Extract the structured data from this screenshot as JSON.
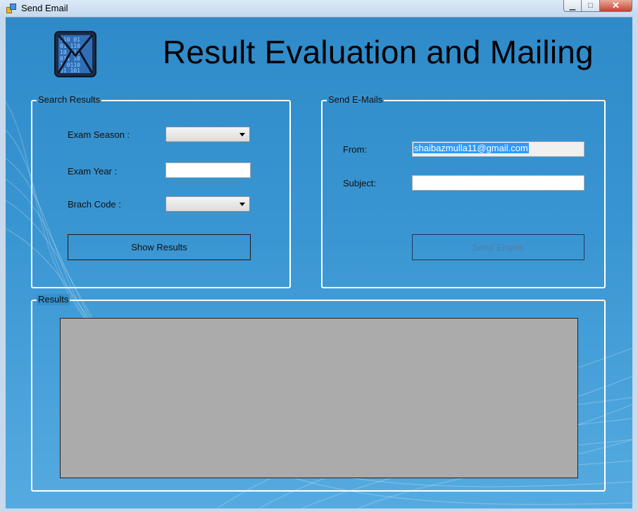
{
  "window": {
    "title": "Send Email",
    "min_glyph": "▁",
    "max_glyph": "□",
    "close_glyph": "✕"
  },
  "header": {
    "title": "Result Evaluation and Mailing",
    "logo_icon": "mail-binary-icon"
  },
  "search_group": {
    "legend": "Search Results",
    "exam_season_label": "Exam Season :",
    "exam_season_value": "",
    "exam_year_label": "Exam Year :",
    "exam_year_value": "",
    "branch_code_label": "Brach Code :",
    "branch_code_value": "",
    "show_results_label": "Show Results"
  },
  "email_group": {
    "legend": "Send E-Mails",
    "from_label": "From:",
    "from_value": "shaibazmulla11@gmail.com",
    "subject_label": "Subject:",
    "subject_value": "",
    "send_label": "Send Emails"
  },
  "results_group": {
    "legend": "Results"
  },
  "colors": {
    "background": "#3590cd",
    "grid": "#ababab",
    "border": "#ffffff"
  }
}
